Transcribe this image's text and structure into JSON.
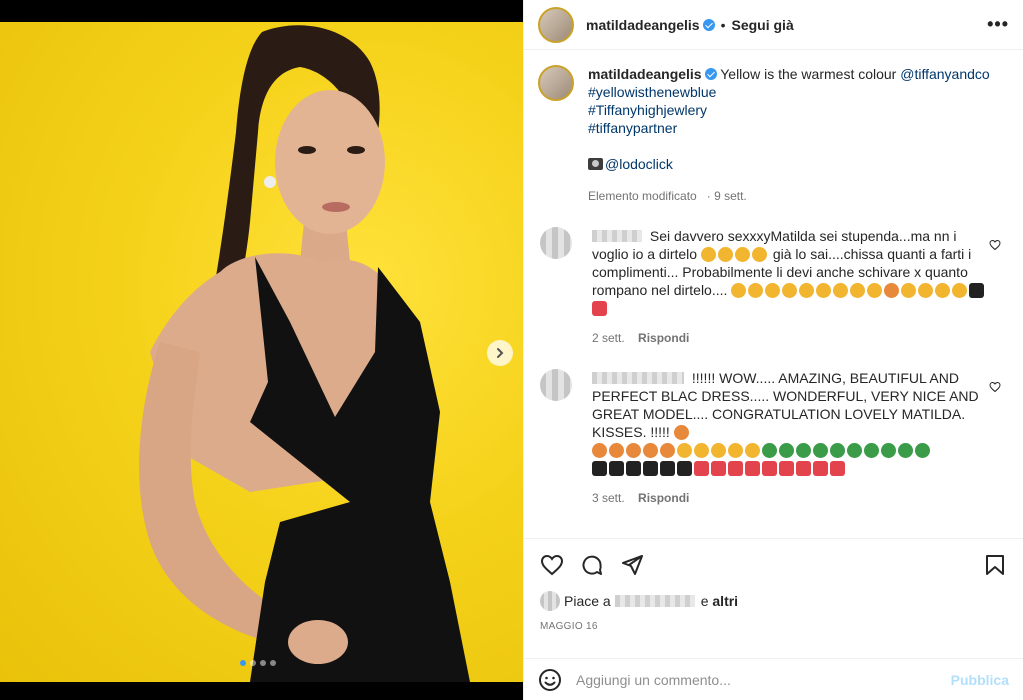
{
  "post": {
    "username": "matildadeangelis",
    "follow_label": "Segui già",
    "more_label": "•••"
  },
  "caption": {
    "username": "matildadeangelis",
    "text": "Yellow is the warmest colour",
    "mention": "@tiffanyandco",
    "hashtags": [
      "#yellowisthenewblue",
      "#Tiffanyhighjewlery",
      "#tiffanypartner"
    ],
    "photo_credit": "@lodoclick",
    "edited": "Elemento modificato",
    "time": "9 sett."
  },
  "comments": [
    {
      "text": "Sei davvero sexxxyMatilda sei stupenda...ma nn i voglio io a dirtelo",
      "text2": "già lo sai....chissa quanti a farti i complimenti... Probabilmente li devi anche schivare x quanto rompano nel dirtelo....",
      "time": "2 sett.",
      "reply_label": "Rispondi"
    },
    {
      "text": "!!!!!! WOW..... AMAZING, BEAUTIFUL AND PERFECT BLAC DRESS..... WONDERFUL, VERY NICE AND GREAT MODEL.... CONGRATULATION LOVELY MATILDA. KISSES. !!!!!",
      "time": "3 sett.",
      "reply_label": "Rispondi"
    }
  ],
  "likes": {
    "prefix": "Piace a",
    "suffix_and": "e",
    "suffix_others": "altri"
  },
  "date": "MAGGIO 16",
  "composer": {
    "placeholder": "Aggiungi un commento...",
    "publish_label": "Pubblica"
  },
  "colors": {
    "background_yellow": "#f5d21a",
    "accent_blue": "#3897f0",
    "link_blue": "#00376b",
    "publish_disabled": "#b2dffc"
  },
  "carousel": {
    "active_index": 0,
    "count": 4
  }
}
